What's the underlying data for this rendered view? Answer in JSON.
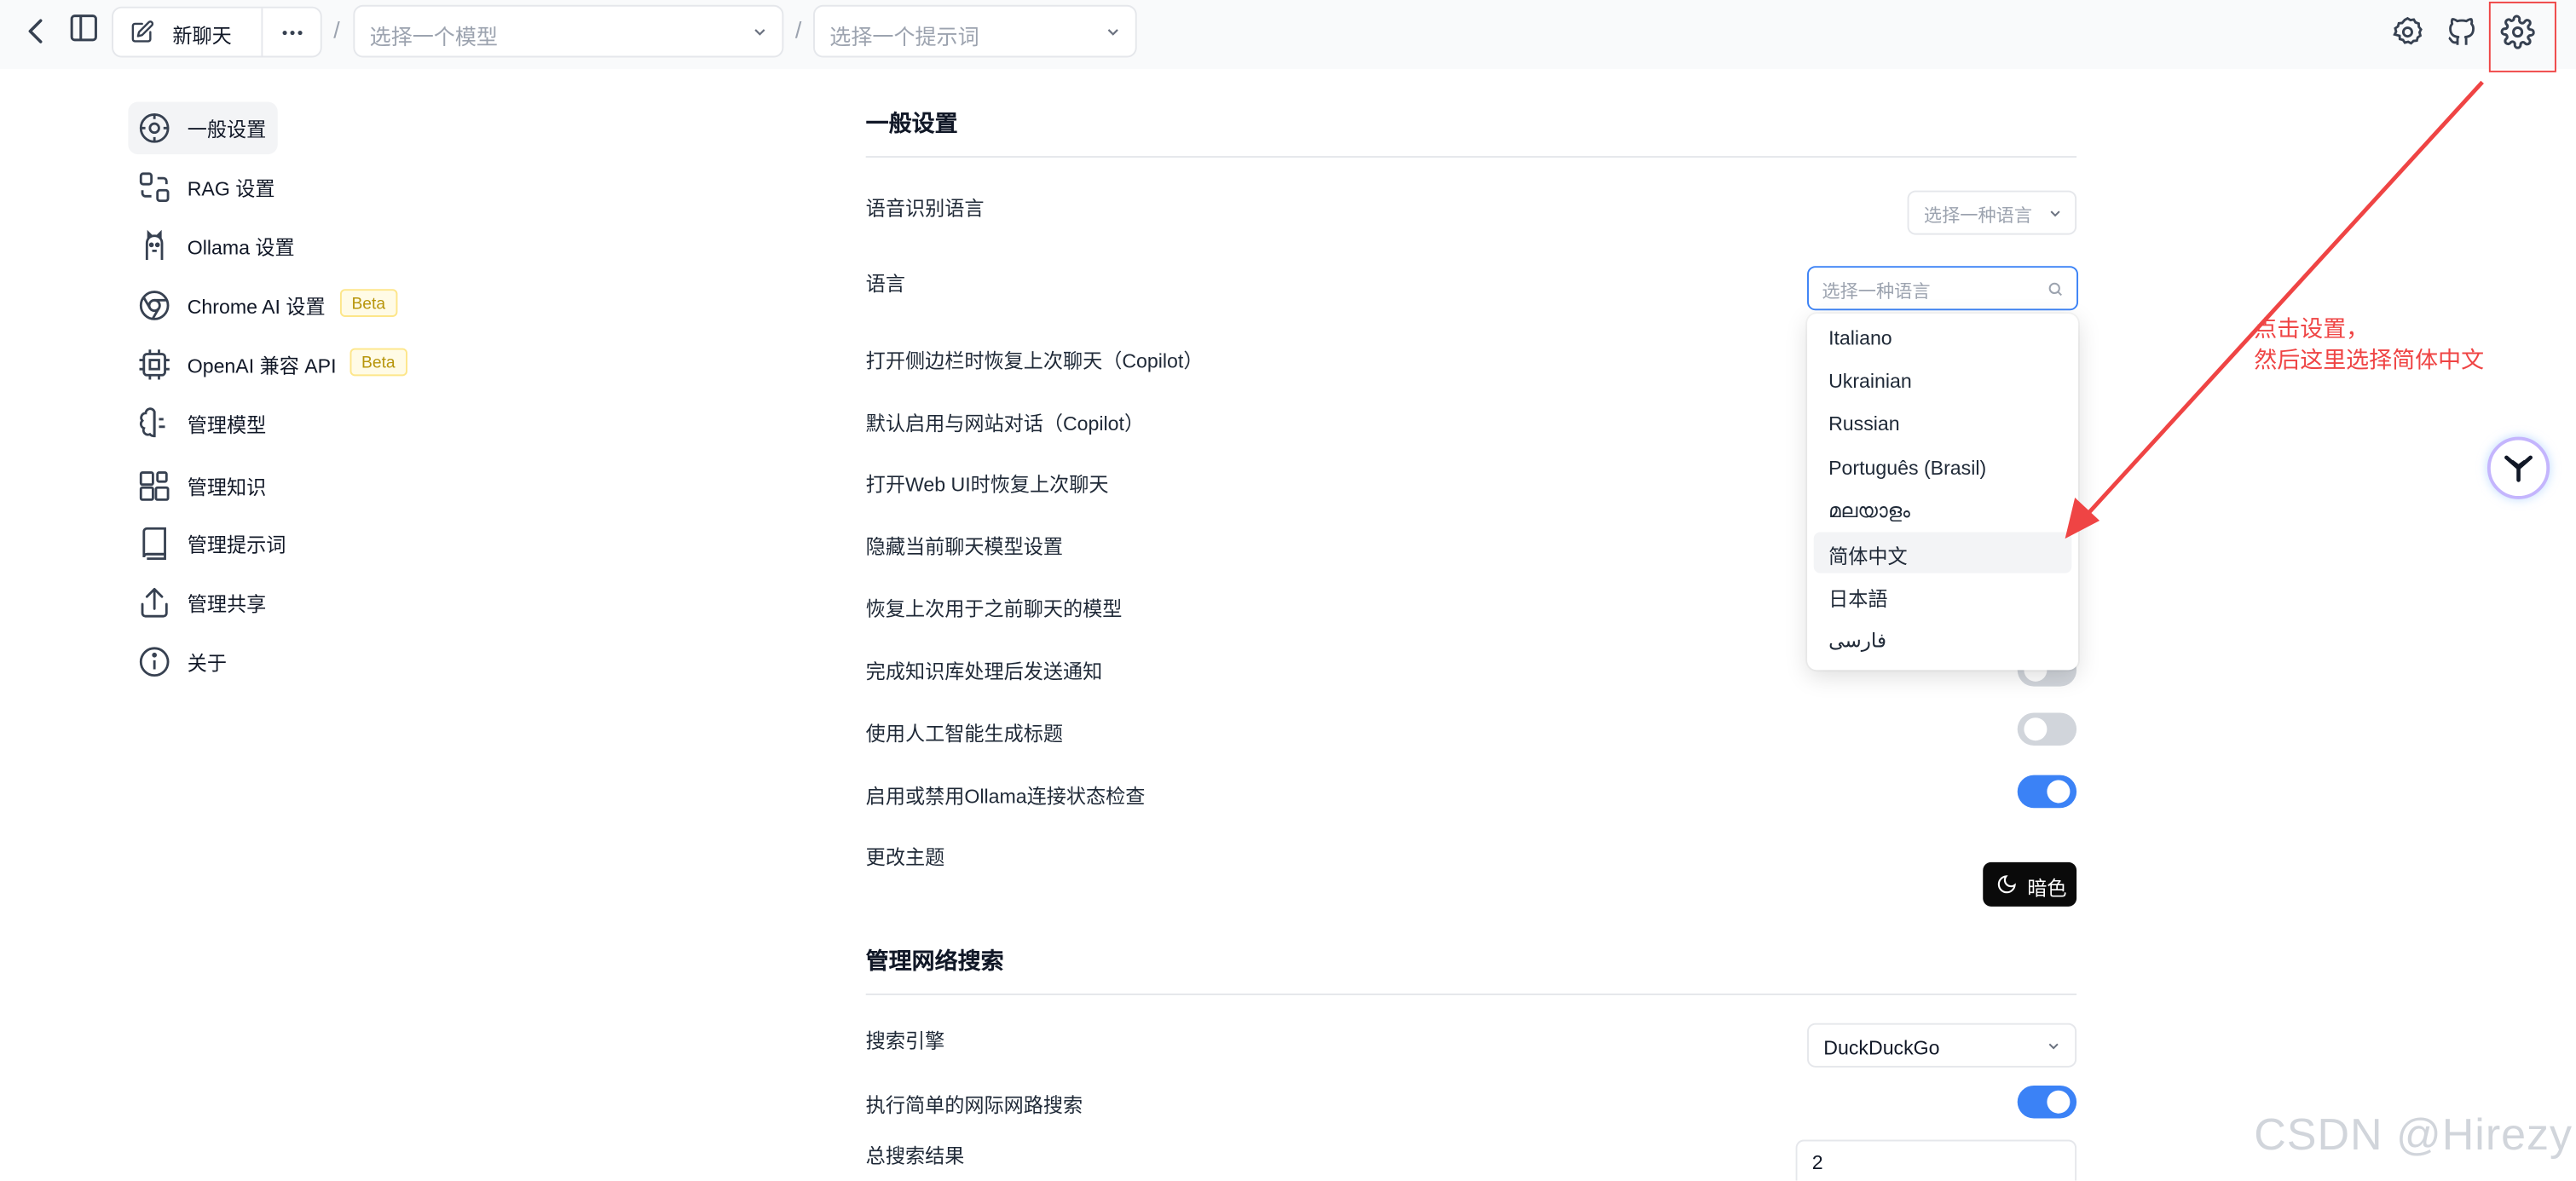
{
  "topbar": {
    "new_chat_label": "新聊天",
    "model_placeholder": "选择一个模型",
    "prompt_placeholder": "选择一个提示词",
    "slash": "/"
  },
  "sidebar": {
    "items": [
      {
        "label": "一般设置",
        "icon": "general-settings-icon",
        "active": true
      },
      {
        "label": "RAG 设置",
        "icon": "rag-icon"
      },
      {
        "label": "Ollama 设置",
        "icon": "ollama-icon"
      },
      {
        "label": "Chrome AI 设置",
        "icon": "chrome-icon",
        "badge": "Beta"
      },
      {
        "label": "OpenAI 兼容 API",
        "icon": "chip-icon",
        "badge": "Beta"
      },
      {
        "label": "管理模型",
        "icon": "brain-icon"
      },
      {
        "label": "管理知识",
        "icon": "blocks-icon"
      },
      {
        "label": "管理提示词",
        "icon": "book-icon"
      },
      {
        "label": "管理共享",
        "icon": "share-icon"
      },
      {
        "label": "关于",
        "icon": "info-icon"
      }
    ]
  },
  "general": {
    "title": "一般设置",
    "speech_lang_label": "语音识别语言",
    "speech_lang_placeholder": "选择一种语言",
    "lang_label": "语言",
    "lang_placeholder": "选择一种语言",
    "rows": [
      {
        "label": "打开侧边栏时恢复上次聊天（Copilot）"
      },
      {
        "label": "默认启用与网站对话（Copilot）"
      },
      {
        "label": "打开Web UI时恢复上次聊天"
      },
      {
        "label": "隐藏当前聊天模型设置"
      },
      {
        "label": "恢复上次用于之前聊天的模型"
      },
      {
        "label": "完成知识库处理后发送通知"
      },
      {
        "label": "使用人工智能生成标题",
        "on": false
      },
      {
        "label": "启用或禁用Ollama连接状态检查",
        "on": true
      }
    ],
    "theme_label": "更改主题",
    "theme_button": "暗色"
  },
  "dropdown": {
    "options": [
      "Italiano",
      "Ukrainian",
      "Russian",
      "Português (Brasil)",
      "മലയാളം",
      "简体中文",
      "日本語",
      "فارسی"
    ],
    "highlighted": "简体中文"
  },
  "web_search": {
    "title": "管理网络搜索",
    "engine_label": "搜索引擎",
    "engine_value": "DuckDuckGo",
    "simple_search_label": "执行简单的网际网路搜索",
    "simple_search_on": true,
    "total_results_label": "总搜索结果",
    "total_results_value": "2"
  },
  "annotation": {
    "line1": "点击设置，",
    "line2": "然后这里选择简体中文",
    "color": "#ef4444"
  },
  "watermark": "CSDN @Hirezy",
  "colors": {
    "accent": "#3b82f6",
    "beta_text": "#b7950b",
    "annotation": "#ef4444"
  }
}
